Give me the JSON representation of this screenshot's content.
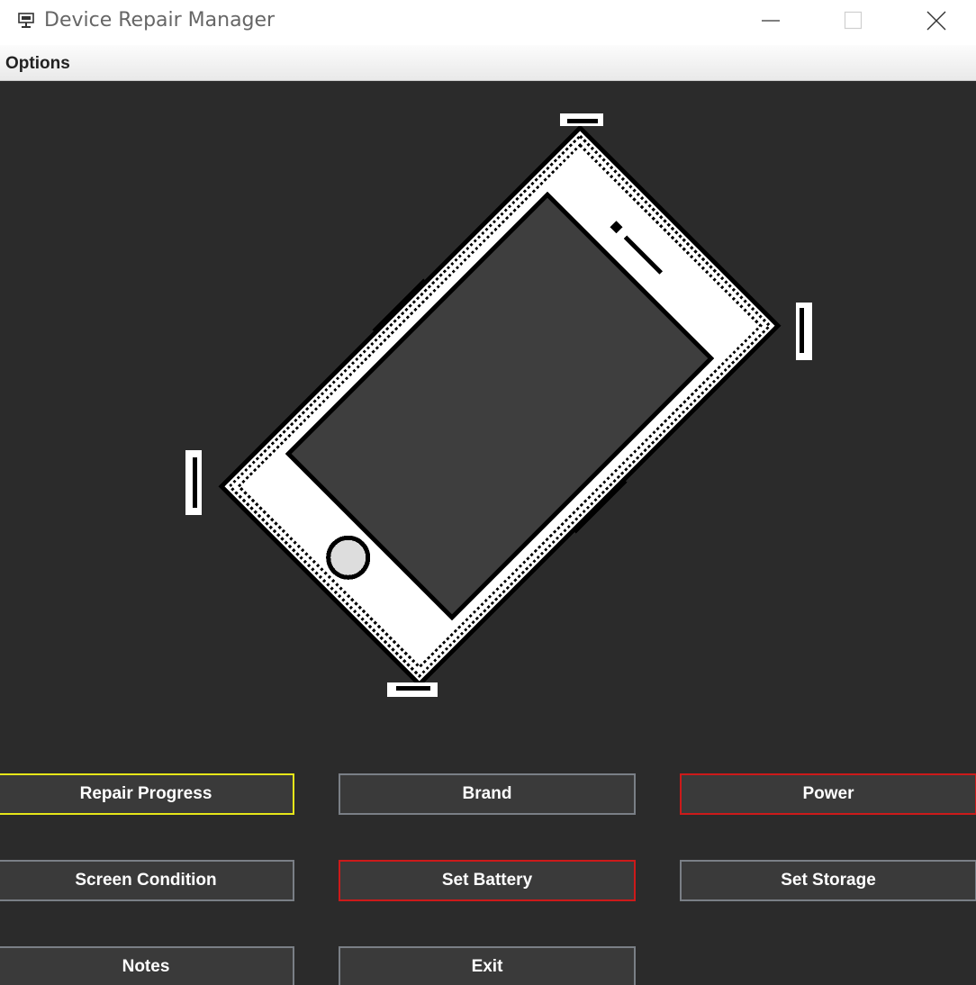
{
  "window": {
    "title": "Device Repair Manager",
    "app_icon": "monitor-repair-icon",
    "controls": [
      "minimize-icon",
      "maximize-icon",
      "close-icon"
    ]
  },
  "menubar": {
    "items": [
      {
        "label": "Options"
      }
    ]
  },
  "device_image": {
    "icon": "phone-icon",
    "screen_color": "#3e3e3e",
    "body_color": "#ffffff",
    "outline_color": "#000000"
  },
  "buttons": [
    {
      "label": "Repair Progress",
      "border_color": "#e6e619"
    },
    {
      "label": "Brand",
      "border_color": "#7a7f86"
    },
    {
      "label": "Power",
      "border_color": "#cc1a1a"
    },
    {
      "label": "Screen Condition",
      "border_color": "#7a7f86"
    },
    {
      "label": "Set Battery",
      "border_color": "#cc1a1a"
    },
    {
      "label": "Set Storage",
      "border_color": "#7a7f86"
    },
    {
      "label": "Notes",
      "border_color": "#7a7f86"
    },
    {
      "label": "Exit",
      "border_color": "#7a7f86"
    }
  ],
  "colors": {
    "background": "#2b2b2b",
    "button_bg": "#3a3a3a",
    "button_text": "#ffffff"
  }
}
